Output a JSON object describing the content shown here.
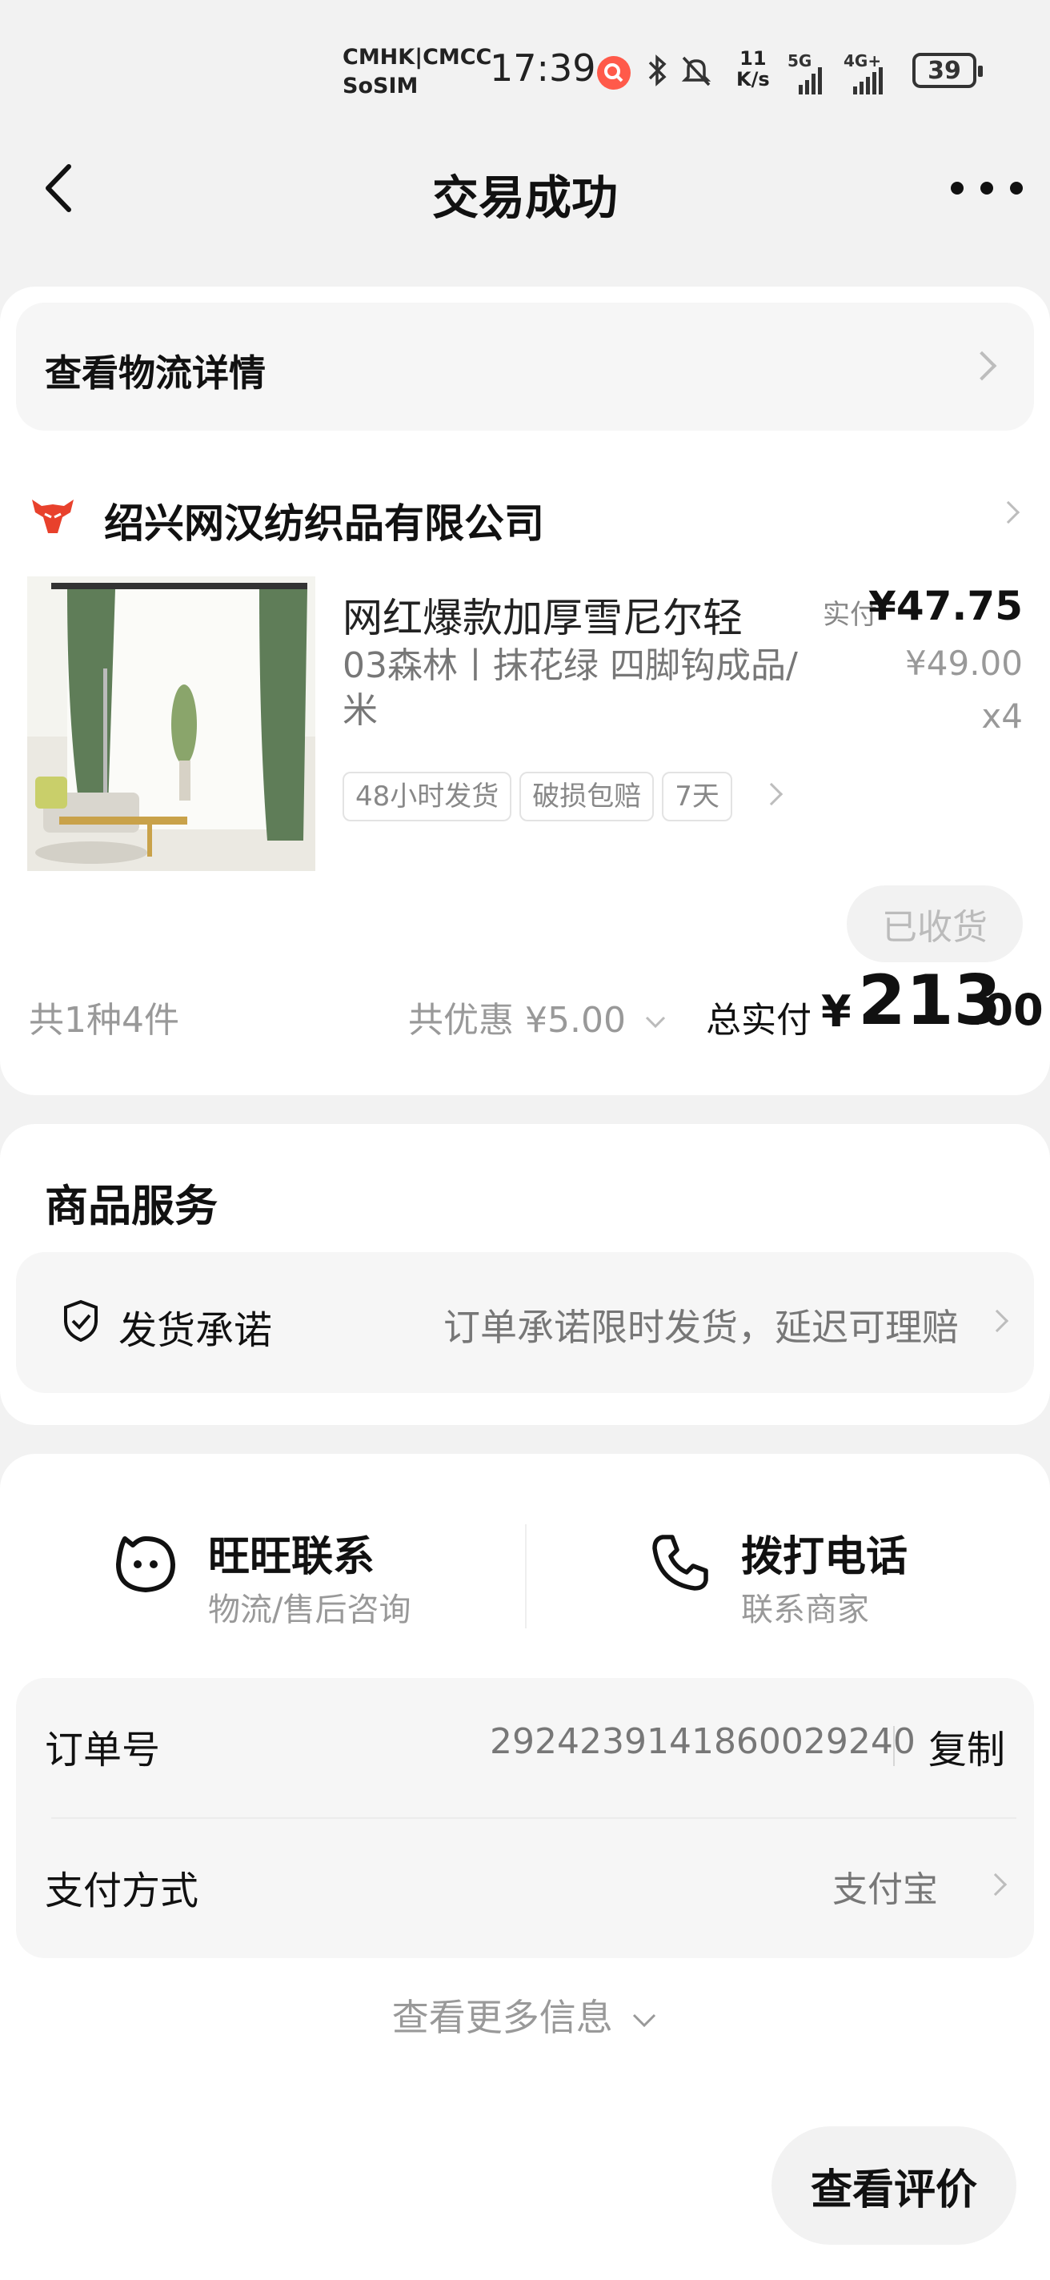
{
  "status_bar": {
    "carrier_line1": "CMHK|CMCC",
    "carrier_line2": "SoSIM",
    "time": "17:39",
    "net_speed_value": "11",
    "net_speed_unit": "K/s",
    "sim1_label": "5G",
    "sim2_label": "4G+",
    "battery": "39"
  },
  "nav": {
    "title": "交易成功"
  },
  "logistics": {
    "label": "查看物流详情"
  },
  "shop": {
    "name": "绍兴网汉纺织品有限公司"
  },
  "product": {
    "title": "网红爆款加厚雪尼尔轻",
    "spec": "03森林丨抹花绿 四脚钩成品/米",
    "tags": [
      "48小时发货",
      "破损包赔",
      "7天"
    ],
    "paid_label": "实付",
    "paid_price": "¥47.75",
    "original_price": "¥49.00",
    "quantity": "x4",
    "status_button": "已收货"
  },
  "summary": {
    "count": "共1种4件",
    "discount": "共优惠 ¥5.00",
    "total_label": "总实付",
    "total_currency": "¥",
    "total_integer": "213",
    "total_decimal": ".00"
  },
  "services": {
    "title": "商品服务",
    "item_label": "发货承诺",
    "item_desc": "订单承诺限时发货，延迟可理赔"
  },
  "contact": {
    "wangwang_title": "旺旺联系",
    "wangwang_sub": "物流/售后咨询",
    "phone_title": "拨打电话",
    "phone_sub": "联系商家"
  },
  "order_info": {
    "order_no_label": "订单号",
    "order_no": "2924239141860029240",
    "copy_label": "复制",
    "payment_label": "支付方式",
    "payment_value": "支付宝",
    "more_label": "查看更多信息"
  },
  "bottom": {
    "review_button": "查看评价"
  },
  "colors": {
    "page_bg": "#f2f2f2",
    "card_bg": "#ffffff",
    "shop_logo": "#e8412c",
    "curtain_green": "#5f7d58"
  }
}
